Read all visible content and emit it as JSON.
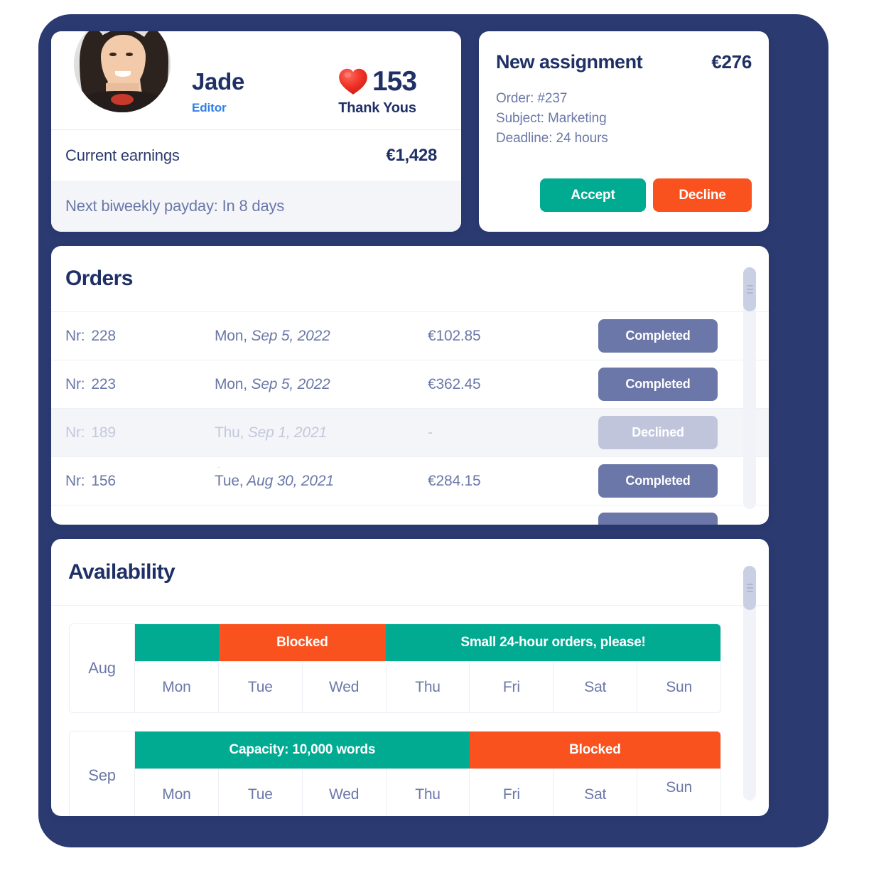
{
  "theme": {
    "frame_navy": "#2b3a70",
    "accent_blue": "#2f7fe8",
    "deep_navy": "#1f3066",
    "slate": "#6b78a8",
    "green": "#00ab92",
    "orange": "#f9521e",
    "badge_completed": "#6b77a8",
    "badge_declined": "#c0c5dc",
    "panel_grey": "#f4f5f9"
  },
  "profile": {
    "avatar_icon": "user-avatar-photo",
    "name": "Jade",
    "role": "Editor",
    "thanks": {
      "icon": "heart-icon",
      "count": "153",
      "label": "Thank Yous"
    },
    "earnings_label": "Current earnings",
    "earnings_value": "€1,428",
    "payday_text": "Next biweekly payday: In 8 days"
  },
  "assignment": {
    "title": "New assignment",
    "price": "€276",
    "meta": [
      "Order: #237",
      "Subject: Marketing",
      "Deadline: 24 hours"
    ],
    "accept_label": "Accept",
    "decline_label": "Decline"
  },
  "orders": {
    "title": "Orders",
    "nr_label": "Nr:",
    "rows": [
      {
        "nr": "228",
        "date_day": "Mon,",
        "date_rest": " Sep 5, 2022",
        "amount": "€102.85",
        "status": "Completed",
        "state": "completed"
      },
      {
        "nr": "223",
        "date_day": "Mon,",
        "date_rest": " Sep 5, 2022",
        "amount": "€362.45",
        "status": "Completed",
        "state": "completed"
      },
      {
        "nr": "189",
        "date_day": "Thu,",
        "date_rest": " Sep 1, 2021",
        "amount": "-",
        "status": "Declined",
        "state": "declined"
      },
      {
        "nr": "156",
        "date_day": "Tue,",
        "date_rest": " Aug 30, 2021",
        "amount": "€284.15",
        "status": "Completed",
        "state": "completed"
      }
    ],
    "scrollbar_icon": "vertical-scrollbar"
  },
  "availability": {
    "title": "Availability",
    "scrollbar_icon": "vertical-scrollbar",
    "months": [
      {
        "label": "Aug",
        "days": [
          "Mon",
          "Tue",
          "Wed",
          "Thu",
          "Fri",
          "Sat",
          "Sun"
        ],
        "bars": [
          {
            "label": "",
            "color": "green",
            "span": 1
          },
          {
            "label": "Blocked",
            "color": "orange",
            "span": 2
          },
          {
            "label": "Small 24-hour orders, please!",
            "color": "green",
            "span": 4
          }
        ]
      },
      {
        "label": "Sep",
        "days": [
          "Mon",
          "Tue",
          "Wed",
          "Thu",
          "Fri",
          "Sat",
          "Sun"
        ],
        "bars": [
          {
            "label": "Capacity: 10,000 words",
            "color": "green",
            "span": 4
          },
          {
            "label": "Blocked",
            "color": "orange",
            "span": 3
          }
        ]
      }
    ]
  }
}
